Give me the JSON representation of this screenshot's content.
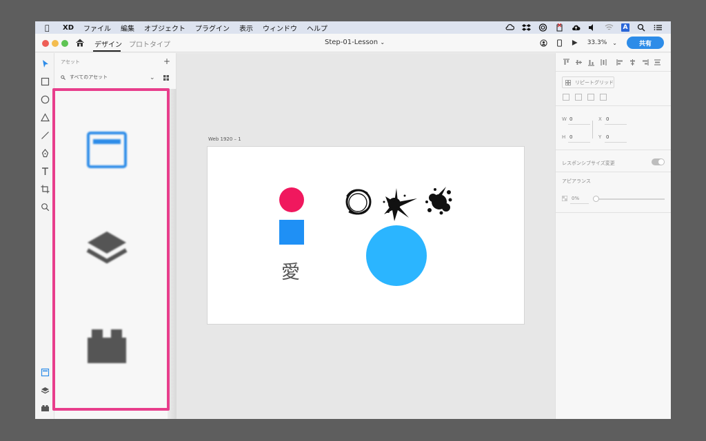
{
  "menubar": {
    "items": [
      "XD",
      "ファイル",
      "編集",
      "オブジェクト",
      "プラグイン",
      "表示",
      "ウィンドウ",
      "ヘルプ"
    ]
  },
  "titlebar": {
    "tabs": [
      "デザイン",
      "プロトタイプ"
    ],
    "doc_title": "Step-01-Lesson",
    "zoom": "33.3%",
    "share_label": "共有"
  },
  "assets": {
    "header": "アセット",
    "search_placeholder": "すべてのアセット"
  },
  "canvas": {
    "artboard_label": "Web 1920 – 1",
    "text": "愛",
    "colors": {
      "red": "#f0185e",
      "blue": "#1f90f5",
      "cyan": "#2bb5ff"
    }
  },
  "properties": {
    "repeat_grid": "リピートグリッド",
    "w_label": "W",
    "w_value": "0",
    "h_label": "H",
    "h_value": "0",
    "x_label": "X",
    "x_value": "0",
    "y_label": "Y",
    "y_value": "0",
    "responsive_resize": "レスポンシブサイズ変更",
    "appearance": "アピアランス",
    "opacity": "0%"
  },
  "highlight_color": "#e83e8c"
}
